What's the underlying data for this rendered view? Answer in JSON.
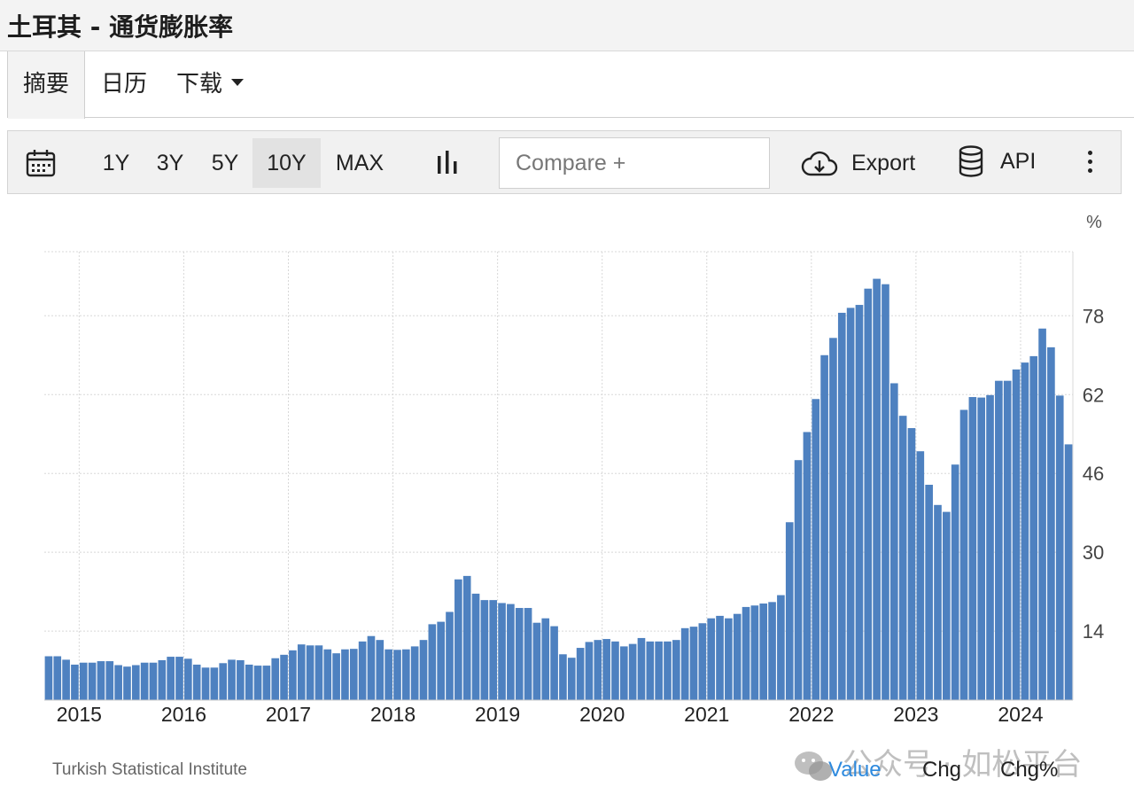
{
  "page": {
    "title": "土耳其 - 通货膨胀率"
  },
  "tabs": [
    {
      "label": "摘要",
      "active": true
    },
    {
      "label": "日历",
      "active": false
    },
    {
      "label": "下载",
      "active": false
    }
  ],
  "toolbar": {
    "ranges": [
      {
        "label": "1Y",
        "active": false
      },
      {
        "label": "3Y",
        "active": false
      },
      {
        "label": "5Y",
        "active": false
      },
      {
        "label": "10Y",
        "active": true
      },
      {
        "label": "MAX",
        "active": false
      }
    ],
    "compare_placeholder": "Compare +",
    "export_label": "Export",
    "api_label": "API"
  },
  "footer": {
    "source": "Turkish Statistical Institute",
    "legend": [
      {
        "label": "Value",
        "color": "#2e8ade",
        "active": true
      },
      {
        "label": "Chg",
        "color": "#222222",
        "active": false
      },
      {
        "label": "Chg%",
        "color": "#222222",
        "active": false
      }
    ],
    "watermark": "公众号 · 如松平台"
  },
  "chart_data": {
    "type": "bar",
    "unit": "%",
    "bar_color": "#4e81c0",
    "grid": true,
    "x_ticks": [
      "2015",
      "2016",
      "2017",
      "2018",
      "2019",
      "2020",
      "2021",
      "2022",
      "2023",
      "2024"
    ],
    "y_ticks": [
      14,
      30,
      46,
      62,
      78
    ],
    "ylim": [
      0,
      91
    ],
    "x_start": "2014-09",
    "values": [
      8.9,
      8.9,
      8.2,
      7.2,
      7.6,
      7.6,
      7.9,
      7.9,
      7.1,
      6.8,
      7.1,
      7.6,
      7.6,
      8.1,
      8.8,
      8.8,
      8.4,
      7.2,
      6.6,
      6.6,
      7.5,
      8.2,
      8.1,
      7.2,
      7,
      7,
      8.5,
      9.2,
      10.1,
      11.3,
      11.1,
      11.1,
      10.3,
      9.5,
      10.3,
      10.4,
      11.9,
      13,
      12.2,
      10.3,
      10.2,
      10.3,
      10.9,
      12.2,
      15.4,
      15.9,
      17.9,
      24.5,
      25.2,
      21.6,
      20.3,
      20.3,
      19.7,
      19.5,
      18.7,
      18.7,
      15.7,
      16.6,
      15,
      9.3,
      8.6,
      10.6,
      11.8,
      12.2,
      12.4,
      11.9,
      10.9,
      11.4,
      12.6,
      11.9,
      11.9,
      11.9,
      12.2,
      14.6,
      14.9,
      15.6,
      16.6,
      17.1,
      16.6,
      17.5,
      18.9,
      19.2,
      19.6,
      19.9,
      21.3,
      36.1,
      48.7,
      54.4,
      61.1,
      70,
      73.5,
      78.6,
      79.6,
      80.2,
      83.5,
      85.5,
      84.4,
      64.3,
      57.7,
      55.2,
      50.5,
      43.7,
      39.6,
      38.2,
      47.8,
      58.9,
      61.5,
      61.4,
      61.9,
      64.8,
      64.8,
      67.1,
      68.5,
      69.8,
      75.4,
      71.6,
      61.8,
      51.9
    ]
  }
}
